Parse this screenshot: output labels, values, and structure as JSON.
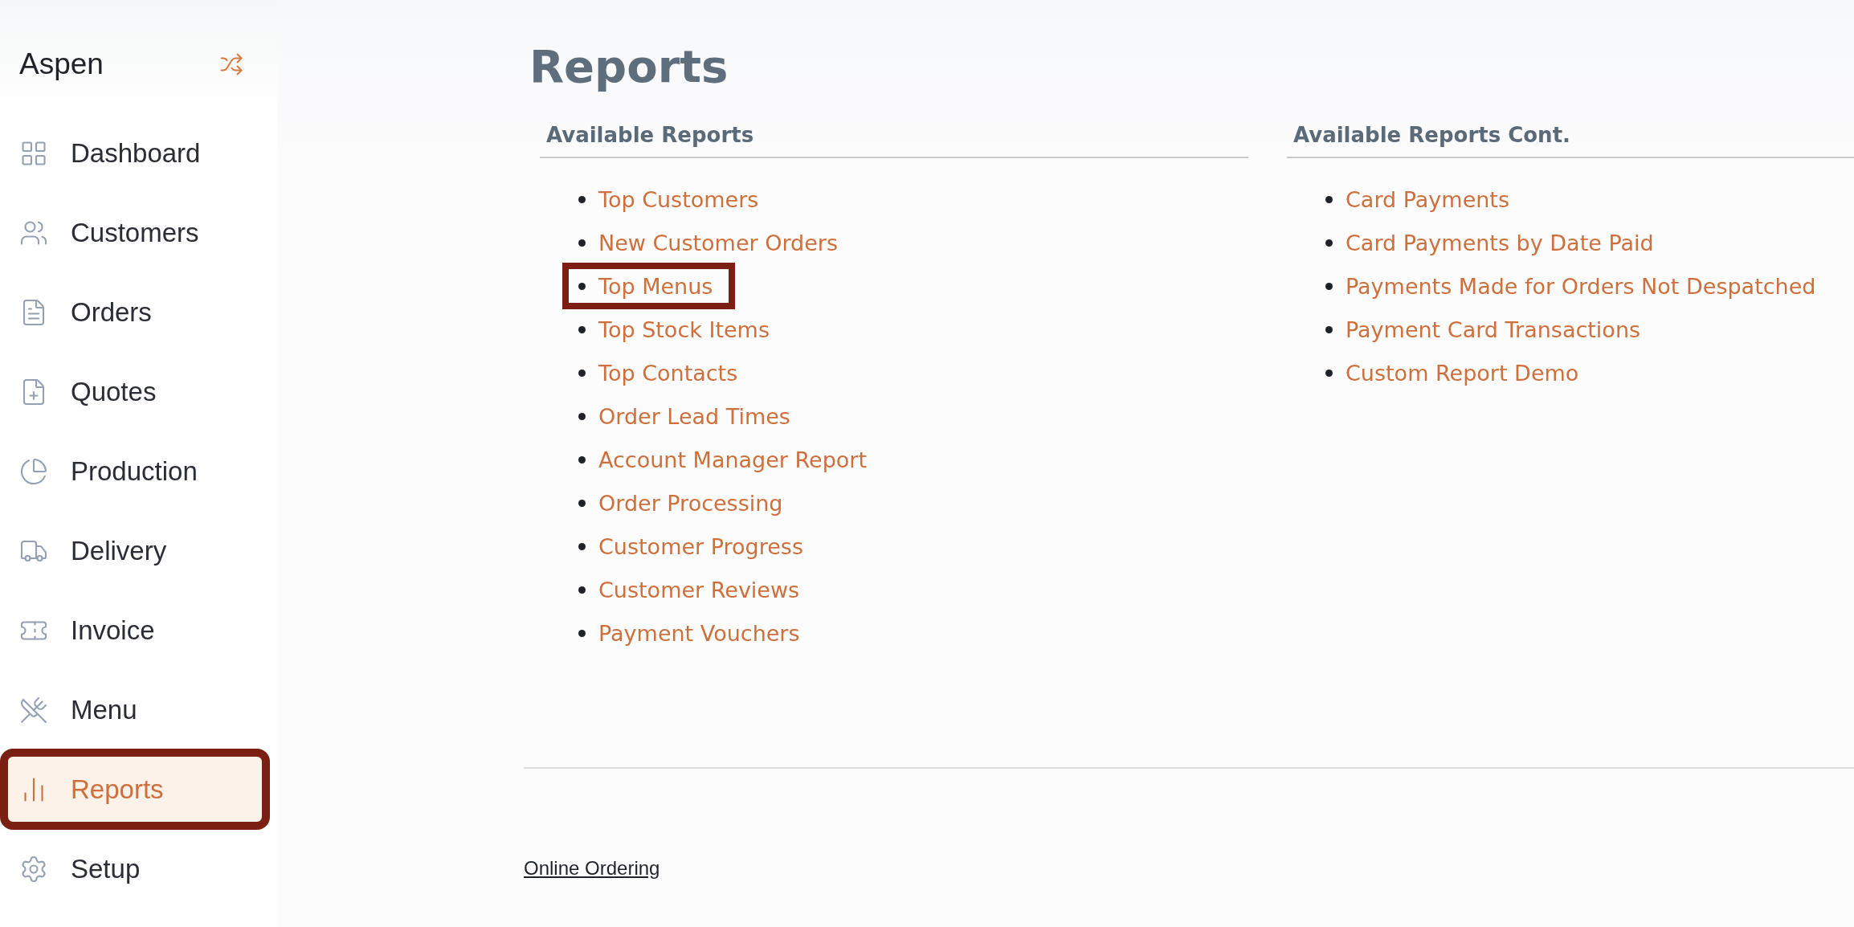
{
  "sidebar": {
    "brand": "Aspen",
    "items": [
      {
        "label": "Dashboard",
        "selected": false,
        "highlighted": false
      },
      {
        "label": "Customers",
        "selected": false,
        "highlighted": false
      },
      {
        "label": "Orders",
        "selected": false,
        "highlighted": false
      },
      {
        "label": "Quotes",
        "selected": false,
        "highlighted": false
      },
      {
        "label": "Production",
        "selected": false,
        "highlighted": false
      },
      {
        "label": "Delivery",
        "selected": false,
        "highlighted": false
      },
      {
        "label": "Invoice",
        "selected": false,
        "highlighted": false
      },
      {
        "label": "Menu",
        "selected": false,
        "highlighted": false
      },
      {
        "label": "Reports",
        "selected": true,
        "highlighted": true
      },
      {
        "label": "Setup",
        "selected": false,
        "highlighted": false
      }
    ]
  },
  "page": {
    "title": "Reports",
    "sections": [
      {
        "heading": "Available Reports",
        "links": [
          {
            "label": "Top Customers",
            "highlighted": false
          },
          {
            "label": "New Customer Orders",
            "highlighted": false
          },
          {
            "label": "Top Menus",
            "highlighted": true
          },
          {
            "label": "Top Stock Items",
            "highlighted": false
          },
          {
            "label": "Top Contacts",
            "highlighted": false
          },
          {
            "label": "Order Lead Times",
            "highlighted": false
          },
          {
            "label": "Account Manager Report",
            "highlighted": false
          },
          {
            "label": "Order Processing",
            "highlighted": false
          },
          {
            "label": "Customer Progress",
            "highlighted": false
          },
          {
            "label": "Customer Reviews",
            "highlighted": false
          },
          {
            "label": "Payment Vouchers",
            "highlighted": false
          }
        ]
      },
      {
        "heading": "Available Reports Cont.",
        "links": [
          {
            "label": "Card Payments",
            "highlighted": false
          },
          {
            "label": "Card Payments by Date Paid",
            "highlighted": false
          },
          {
            "label": "Payments Made for Orders Not Despatched",
            "highlighted": false
          },
          {
            "label": "Payment Card Transactions",
            "highlighted": false
          },
          {
            "label": "Custom Report Demo",
            "highlighted": false
          }
        ]
      }
    ],
    "footer_link": "Online Ordering"
  }
}
